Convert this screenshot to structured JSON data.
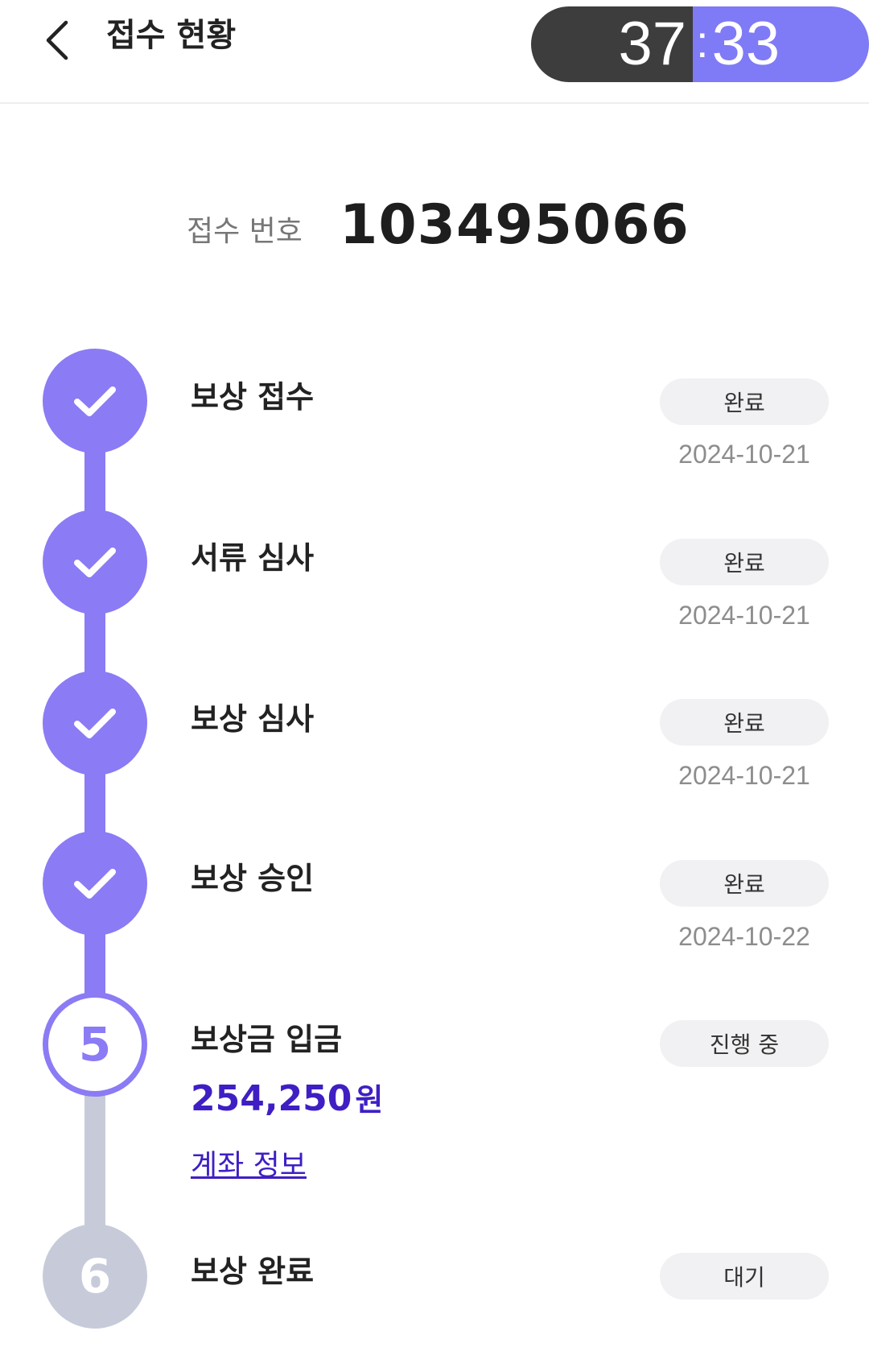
{
  "header": {
    "title": "접수 현황",
    "timer_minutes": "37",
    "timer_colon": ":",
    "timer_seconds": "33"
  },
  "receipt": {
    "label": "접수 번호",
    "number": "103495066"
  },
  "steps": [
    {
      "title": "보상 접수",
      "status": "완료",
      "date": "2024-10-21",
      "state": "done"
    },
    {
      "title": "서류 심사",
      "status": "완료",
      "date": "2024-10-21",
      "state": "done"
    },
    {
      "title": "보상 심사",
      "status": "완료",
      "date": "2024-10-21",
      "state": "done"
    },
    {
      "title": "보상 승인",
      "status": "완료",
      "date": "2024-10-22",
      "state": "done"
    },
    {
      "title": "보상금 입금",
      "status": "진행 중",
      "number": "5",
      "state": "active",
      "amount": "254,250",
      "amount_unit": "원",
      "account_link": "계좌 정보"
    },
    {
      "title": "보상 완료",
      "status": "대기",
      "number": "6",
      "state": "pending"
    }
  ],
  "colors": {
    "accent": "#8b7bf4",
    "amount": "#3f1fc4",
    "pending": "#c7cbd9",
    "timer_dark": "#3d3d3d",
    "timer_accent": "#7f7af5"
  }
}
